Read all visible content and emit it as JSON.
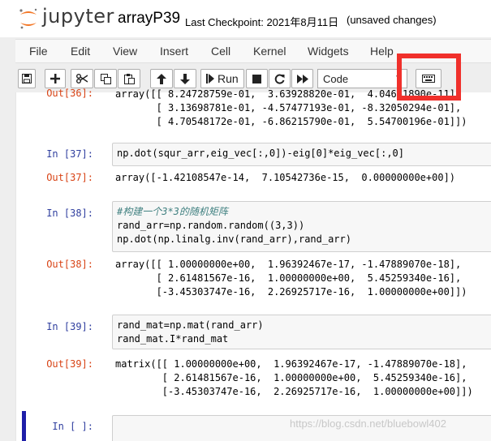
{
  "header": {
    "logo_text": "jupyter",
    "notebook_name": "arrayP39",
    "checkpoint": "Last Checkpoint: 2021年8月11日",
    "status": "(unsaved changes)"
  },
  "menu": [
    "File",
    "Edit",
    "View",
    "Insert",
    "Cell",
    "Kernel",
    "Widgets",
    "Help"
  ],
  "toolbar": {
    "run_label": "Run",
    "cell_type": "Code"
  },
  "cells": {
    "top_output": {
      "prompt": "Out[36]:",
      "lines": [
        "array([[ 8.24728759e-01,  3.63928820e-01,  4.04661890e-11],",
        "       [ 3.13698781e-01, -4.57477193e-01, -8.32050294e-01],",
        "       [ 4.70548172e-01, -6.86215790e-01,  5.54700196e-01]])"
      ]
    },
    "c37": {
      "in_prompt": "In  [37]:",
      "code": "np.dot(squr_arr,eig_vec[:,0])-eig[0]*eig_vec[:,0]",
      "out_prompt": "Out[37]:",
      "output": "array([-1.42108547e-14,  7.10542736e-15,  0.00000000e+00])"
    },
    "c38": {
      "in_prompt": "In  [38]:",
      "code": [
        "#构建一个3*3的随机矩阵",
        "rand_arr=np.random.random((3,3))",
        "np.dot(np.linalg.inv(rand_arr),rand_arr)"
      ],
      "out_prompt": "Out[38]:",
      "output": [
        "array([[ 1.00000000e+00,  1.96392467e-17, -1.47889070e-18],",
        "       [ 2.61481567e-16,  1.00000000e+00,  5.45259340e-16],",
        "       [-3.45303747e-16,  2.26925717e-16,  1.00000000e+00]])"
      ]
    },
    "c39": {
      "in_prompt": "In  [39]:",
      "code": [
        "rand_mat=np.mat(rand_arr)",
        "rand_mat.I*rand_mat"
      ],
      "out_prompt": "Out[39]:",
      "output": [
        "matrix([[ 1.00000000e+00,  1.96392467e-17, -1.47889070e-18],",
        "        [ 2.61481567e-16,  1.00000000e+00,  5.45259340e-16],",
        "        [-3.45303747e-16,  2.26925717e-16,  1.00000000e+00]])"
      ]
    },
    "empty": {
      "in_prompt": "In  [ ]:"
    }
  },
  "watermark": "https://blog.csdn.net/bluebowl402",
  "colors": {
    "highlight": "#f0302b",
    "in_prompt": "#303f9f",
    "out_prompt": "#d84315",
    "logo_orange": "#f37726",
    "selected_cell": "#1e1ea8"
  },
  "icons": [
    "save-icon",
    "plus-icon",
    "cut-icon",
    "copy-icon",
    "paste-icon",
    "arrow-up-icon",
    "arrow-down-icon",
    "play-icon",
    "stop-icon",
    "restart-icon",
    "fast-forward-icon",
    "keyboard-icon"
  ]
}
